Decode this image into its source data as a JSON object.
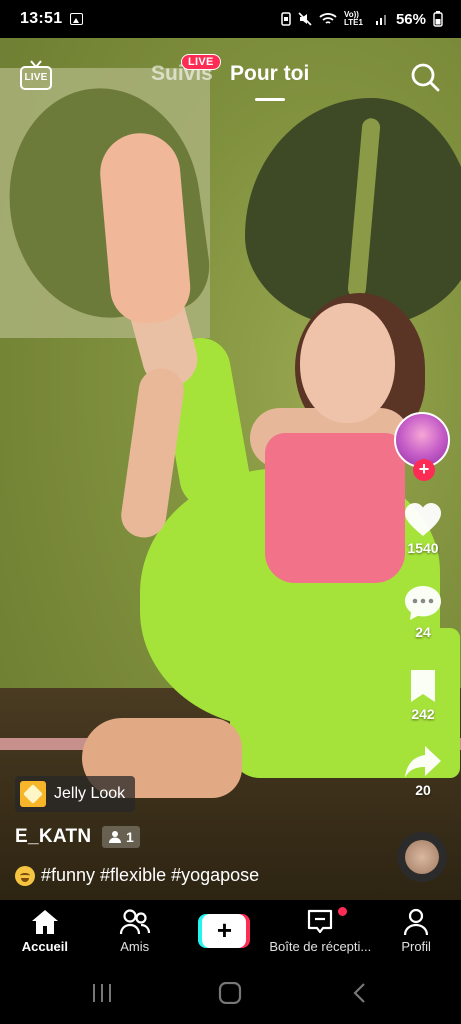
{
  "status_bar": {
    "time": "13:51",
    "network_label": "Vo)) LTE1",
    "battery": "56%"
  },
  "top_nav": {
    "live_label": "LIVE",
    "tabs": [
      {
        "label": "Suivis",
        "badge": "LIVE"
      },
      {
        "label": "Pour toi",
        "active": true
      }
    ]
  },
  "actions": {
    "likes": "1540",
    "comments": "24",
    "saves": "242",
    "shares": "20"
  },
  "post": {
    "effect_label": "Jelly Look",
    "username": "E_KATN",
    "friends_count": "1",
    "caption": "#funny #flexible #yogapose"
  },
  "bottom_nav": {
    "items": [
      {
        "label": "Accueil",
        "icon": "home-icon",
        "active": true
      },
      {
        "label": "Amis",
        "icon": "friends-icon"
      },
      {
        "label": "",
        "icon": "plus-icon"
      },
      {
        "label": "Boîte de récepti...",
        "icon": "inbox-icon"
      },
      {
        "label": "Profil",
        "icon": "profile-icon"
      }
    ]
  },
  "colors": {
    "accent": "#fe2c55",
    "create_cyan": "#25f4ee"
  }
}
